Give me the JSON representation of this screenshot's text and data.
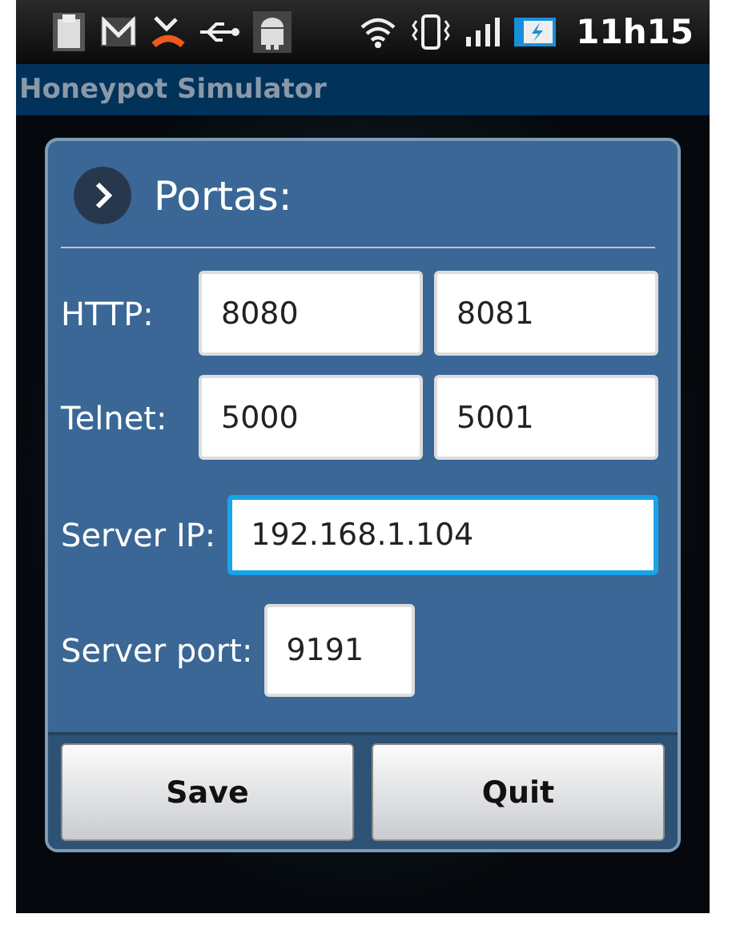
{
  "status_bar": {
    "time": "11h15"
  },
  "app_title": "Honeypot Simulator",
  "dialog": {
    "title": "Portas:",
    "rows": [
      {
        "kind": "pair",
        "label": "HTTP:",
        "fields": [
          {
            "value": "8080",
            "focused": false
          },
          {
            "value": "8081",
            "focused": false
          }
        ]
      },
      {
        "kind": "pair",
        "label": "Telnet:",
        "fields": [
          {
            "value": "5000",
            "focused": false
          },
          {
            "value": "5001",
            "focused": false
          }
        ]
      },
      {
        "kind": "wide",
        "label": "Server IP:",
        "fields": [
          {
            "value": "192.168.1.104",
            "focused": true
          }
        ]
      },
      {
        "kind": "short",
        "label": "Server port:",
        "fields": [
          {
            "value": "9191",
            "focused": false
          }
        ]
      }
    ],
    "buttons": [
      "Save",
      "Quit"
    ]
  }
}
